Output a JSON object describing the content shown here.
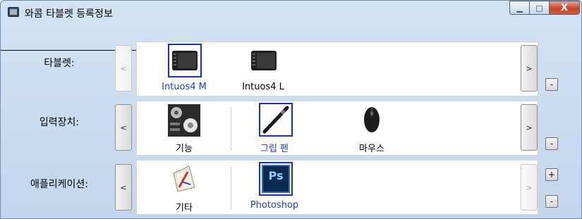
{
  "window": {
    "title": "와콤 타블렛 등록정보",
    "minimize_glyph": "▁",
    "maximize_glyph": "□",
    "close_glyph": "X"
  },
  "rows": {
    "tablet": {
      "label": "타블렛:",
      "prev_glyph": "<",
      "next_glyph": ">",
      "remove_glyph": "-",
      "items": [
        {
          "label": "Intuos4 M",
          "icon": "tablet-icon",
          "selected": true
        },
        {
          "label": "Intuos4 L",
          "icon": "tablet-icon",
          "selected": false
        }
      ]
    },
    "input_device": {
      "label": "입력장치:",
      "prev_glyph": "<",
      "next_glyph": ">",
      "remove_glyph": "-",
      "items": [
        {
          "label": "기능",
          "icon": "functions-icon",
          "selected": false
        },
        {
          "label": "그립 펜",
          "icon": "pen-icon",
          "selected": true
        },
        {
          "label": "마우스",
          "icon": "mouse-icon",
          "selected": false
        }
      ]
    },
    "application": {
      "label": "애플리케이션:",
      "prev_glyph": "<",
      "next_glyph": ">",
      "add_glyph": "+",
      "remove_glyph": "-",
      "items": [
        {
          "label": "기타",
          "icon": "all-apps-icon",
          "selected": false
        },
        {
          "label": "Photoshop",
          "icon": "photoshop-icon",
          "selected": true,
          "icon_text": "Ps"
        }
      ]
    }
  },
  "colors": {
    "selection": "#1b2bd6",
    "selected_text": "#1a3cd8",
    "close_button": "#c64628"
  }
}
